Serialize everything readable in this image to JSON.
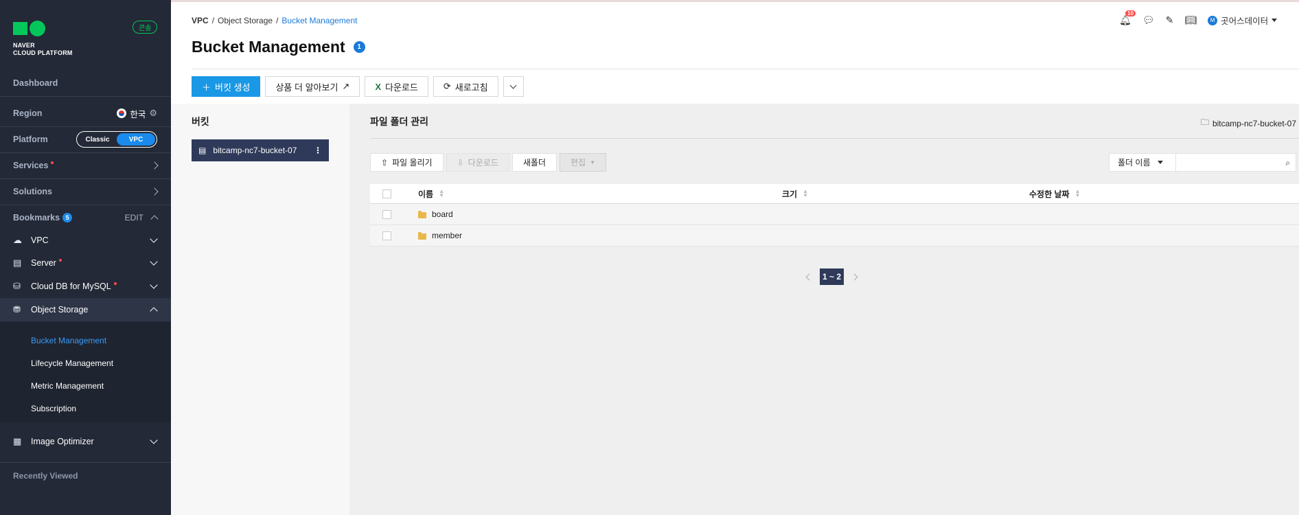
{
  "sidebar": {
    "logo_line1": "NAVER",
    "logo_line2": "CLOUD PLATFORM",
    "console_badge": "콘솔",
    "dashboard": "Dashboard",
    "region_label": "Region",
    "region_value": "한국",
    "platform_label": "Platform",
    "platform_options": [
      "Classic",
      "VPC"
    ],
    "platform_selected": "VPC",
    "services": "Services",
    "solutions": "Solutions",
    "bookmarks_label": "Bookmarks",
    "bookmarks_count": "5",
    "bookmarks_edit": "EDIT",
    "bookmarks": [
      {
        "label": "VPC",
        "icon": "vpc-icon"
      },
      {
        "label": "Server",
        "icon": "server-icon"
      },
      {
        "label": "Cloud DB for MySQL",
        "icon": "database-icon"
      },
      {
        "label": "Object Storage",
        "icon": "storage-icon"
      },
      {
        "label": "Image Optimizer",
        "icon": "image-icon"
      }
    ],
    "object_storage_sub": [
      "Bucket Management",
      "Lifecycle Management",
      "Metric Management",
      "Subscription"
    ],
    "recently_viewed": "Recently Viewed"
  },
  "breadcrumb": [
    "VPC",
    "Object Storage",
    "Bucket Management"
  ],
  "page_title": "Bucket Management",
  "page_title_badge": "1",
  "header": {
    "notification_count": "10",
    "user_initial": "M",
    "user_name": "곳어스데이터"
  },
  "toolbar": {
    "create_bucket": "버킷 생성",
    "learn_more": "상품 더 알아보기",
    "download": "다운로드",
    "refresh": "새로고침"
  },
  "bucket_panel": {
    "title": "버킷",
    "selected_bucket": "bitcamp-nc7-bucket-07"
  },
  "file_area": {
    "title": "파일 폴더 관리",
    "path": "bitcamp-nc7-bucket-07",
    "upload": "파일 올리기",
    "download": "다운로드",
    "new_folder": "새폴더",
    "edit": "편집",
    "search_select": "폴더 이름",
    "columns": [
      "이름",
      "크기",
      "수정한 날짜"
    ],
    "rows": [
      {
        "name": "board",
        "size": "",
        "modified": ""
      },
      {
        "name": "member",
        "size": "",
        "modified": ""
      }
    ],
    "pagination": "1 ~ 2"
  },
  "colors": {
    "sidebar_bg": "#232936",
    "accent": "#1a98e6",
    "active_link": "#3c9cf5",
    "brand_green": "#03c75a",
    "selected_bucket_bg": "#2f3a5a"
  }
}
